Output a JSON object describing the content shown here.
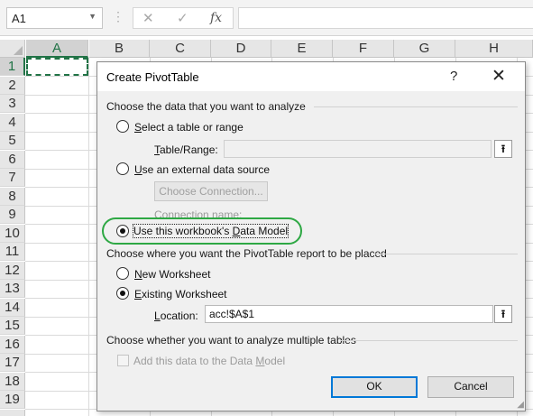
{
  "formula_bar": {
    "name_box": "A1",
    "dots": "⋮",
    "cancel_glyph": "✕",
    "enter_glyph": "✓",
    "fx_label": "fx",
    "formula": ""
  },
  "grid": {
    "columns": [
      "A",
      "B",
      "C",
      "D",
      "E",
      "F",
      "G",
      "H"
    ],
    "rows": [
      "1",
      "2",
      "3",
      "4",
      "5",
      "6",
      "7",
      "8",
      "9",
      "10",
      "11",
      "12",
      "13",
      "14",
      "15",
      "16",
      "17",
      "18",
      "19"
    ],
    "selected_cell": "A1",
    "accent_color": "#217346"
  },
  "dialog": {
    "title": "Create PivotTable",
    "help": "?",
    "close": "✕",
    "section1_label": "Choose the data that you want to analyze",
    "opt_select_table": {
      "underlined": "S",
      "rest": "elect a table or range",
      "checked": false
    },
    "table_range_label_u": "T",
    "table_range_label_rest": "able/Range:",
    "table_range_value": "",
    "opt_external": {
      "underlined": "U",
      "rest": "se an external data source",
      "checked": false
    },
    "choose_connection": "Choose Connection...",
    "connection_name_label": "Connection name:",
    "opt_data_model": {
      "before": "Use this workbook's ",
      "underlined": "D",
      "after": "ata Model",
      "checked": true
    },
    "section2_label": "Choose where you want the PivotTable report to be placed",
    "opt_new_ws": {
      "underlined": "N",
      "rest": "ew Worksheet",
      "checked": false
    },
    "opt_existing_ws": {
      "underlined": "E",
      "rest": "xisting Worksheet",
      "checked": true
    },
    "location_label_u": "L",
    "location_label_rest": "ocation:",
    "location_value": "acc!$A$1",
    "picker_glyph": "⭱",
    "section3_label": "Choose whether you want to analyze multiple tables",
    "add_data_model_u": "M",
    "add_data_model_before": "Add this data to the Data ",
    "add_data_model_after": "odel",
    "ok": "OK",
    "cancel": "Cancel",
    "highlight_color": "#2ea844"
  }
}
